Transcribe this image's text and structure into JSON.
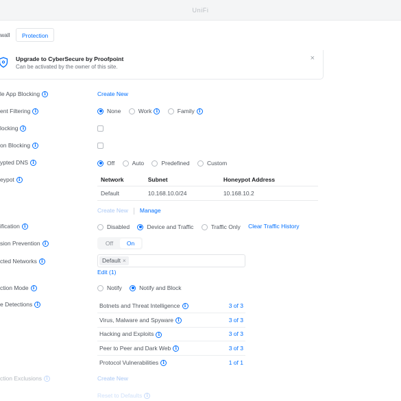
{
  "window": {
    "title": "UniFi"
  },
  "tabs": [
    {
      "label": "wall"
    },
    {
      "label": "Protection"
    }
  ],
  "banner": {
    "icon": "shield-icon",
    "title": "Upgrade to CyberSecure by Proofpoint",
    "subtitle": "Can be activated by the owner of this site.",
    "close": "×"
  },
  "app_blocking": {
    "label": "le App Blocking",
    "action": "Create New"
  },
  "content_filtering": {
    "label": "ent Filtering",
    "options": [
      "None",
      "Work",
      "Family"
    ],
    "selected": "None"
  },
  "ad_blocking": {
    "label": "locking",
    "checked": false
  },
  "region_blocking": {
    "label": "on Blocking",
    "checked": false
  },
  "encrypted_dns": {
    "label": "ypted DNS",
    "options": [
      "Off",
      "Auto",
      "Predefined",
      "Custom"
    ],
    "selected": "Off"
  },
  "honeypot": {
    "label": "eypot",
    "columns": [
      "Network",
      "Subnet",
      "Honeypot Address"
    ],
    "rows": [
      [
        "Default",
        "10.168.10.0/24",
        "10.168.10.2"
      ]
    ],
    "create_new": "Create New",
    "manage": "Manage"
  },
  "identification": {
    "label": "ification",
    "options": [
      "Disabled",
      "Device and Traffic",
      "Traffic Only"
    ],
    "selected": "Device and Traffic",
    "clear_history": "Clear Traffic History"
  },
  "intrusion_prevention": {
    "label": "sion Prevention",
    "off": "Off",
    "on": "On",
    "value": "On"
  },
  "protected_networks": {
    "label": "cted Networks",
    "chip": "Default",
    "chip_remove": "×",
    "edit": "Edit (1)"
  },
  "detection_mode": {
    "label": "ction Mode",
    "options": [
      "Notify",
      "Notify and Block"
    ],
    "selected": "Notify and Block"
  },
  "detections": {
    "label": "e Detections",
    "rows": [
      {
        "name": "Botnets and Threat Intelligence",
        "count": "3 of 3"
      },
      {
        "name": "Virus, Malware and Spyware",
        "count": "3 of 3"
      },
      {
        "name": "Hacking and Exploits",
        "count": "3 of 3"
      },
      {
        "name": "Peer to Peer and Dark Web",
        "count": "3 of 3"
      },
      {
        "name": "Protocol Vulnerabilities",
        "count": "1 of 1"
      }
    ]
  },
  "detection_exclusions": {
    "label": "ction Exclusions",
    "action": "Create New"
  },
  "reset": {
    "label": "Reset to Defaults"
  },
  "colors": {
    "accent": "#006fff",
    "text": "#50565e",
    "muted": "#b3b8be"
  }
}
